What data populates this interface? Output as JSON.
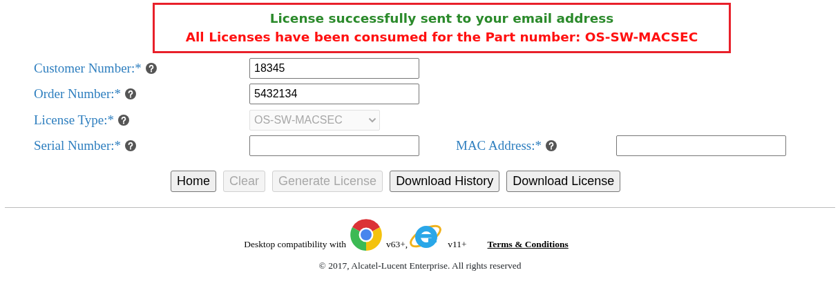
{
  "messages": [
    {
      "kind": "success",
      "text": "License successfully sent to your email address"
    },
    {
      "kind": "error",
      "text": "All Licenses have been consumed for the Part number: OS-SW-MACSEC"
    }
  ],
  "form_rows": [
    [
      {
        "label": "Customer Number:*",
        "kind": "text",
        "value": "18345",
        "disabled": false
      }
    ],
    [
      {
        "label": "Order Number:*",
        "kind": "text",
        "value": "5432134",
        "disabled": false
      }
    ],
    [
      {
        "label": "License Type:*",
        "kind": "select",
        "value": "OS-SW-MACSEC",
        "disabled": true
      }
    ],
    [
      {
        "label": "Serial Number:*",
        "kind": "text",
        "disabled": false
      },
      {
        "label": "MAC Address:*",
        "kind": "text",
        "disabled": false
      }
    ]
  ],
  "buttons": [
    {
      "label": "Home",
      "disabled": false
    },
    {
      "label": "Clear",
      "disabled": true
    },
    {
      "label": "Generate License",
      "disabled": true
    },
    {
      "label": "Download History",
      "disabled": false
    },
    {
      "label": "Download License",
      "disabled": false
    }
  ],
  "footer": {
    "compat_text": "Desktop compatibility with",
    "chrome_version": "v63+,",
    "ie_version": "v11+",
    "terms_link": "Terms & Conditions",
    "copyright": "© 2017, Alcatel-Lucent Enterprise. All rights reserved"
  }
}
